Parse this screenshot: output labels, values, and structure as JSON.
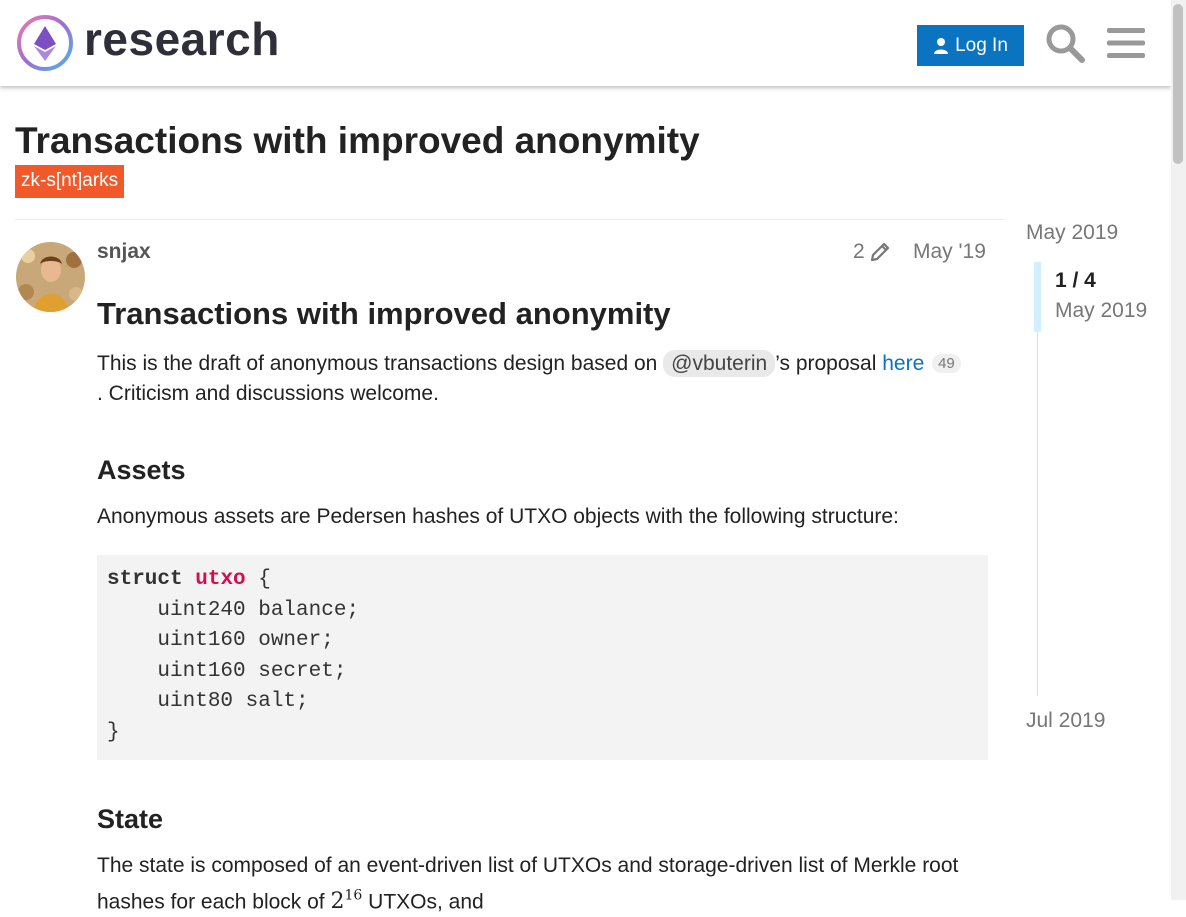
{
  "header": {
    "site_name": "research",
    "login_label": "Log In"
  },
  "topic": {
    "title": "Transactions with improved anonymity",
    "category": "zk-s[nt]arks",
    "category_color": "#f1592a"
  },
  "post": {
    "username": "snjax",
    "edit_count": "2",
    "date": "May '19",
    "heading": "Transactions with improved anonymity",
    "intro_before": "This is the draft of anonymous transactions design based on ",
    "mention": "@vbuterin",
    "intro_mid": "’s proposal ",
    "link_text": "here",
    "link_clicks": "49",
    "intro_after": ". Criticism and discussions welcome.",
    "assets_heading": "Assets",
    "assets_text": "Anonymous assets are Pedersen hashes of UTXO objects with the following structure:",
    "code": {
      "line1_kw": "struct",
      "line1_type": "utxo",
      "line1_rest": " {",
      "line2": "    uint240 balance;",
      "line3": "    uint160 owner;",
      "line4": "    uint160 secret;",
      "line5": "    uint80 salt;",
      "line6": "}"
    },
    "state_heading": "State",
    "state_text_1": "The state is composed of an event-driven list of UTXOs and storage-driven list of Merkle root hashes for each block of ",
    "state_math_base": "2",
    "state_math_exp": "16",
    "state_text_2": " UTXOs, and"
  },
  "timeline": {
    "start": "May 2019",
    "position": "1 / 4",
    "current_date": "May 2019",
    "end": "Jul 2019"
  },
  "colors": {
    "accent": "#0a74c0",
    "category": "#f1592a"
  }
}
